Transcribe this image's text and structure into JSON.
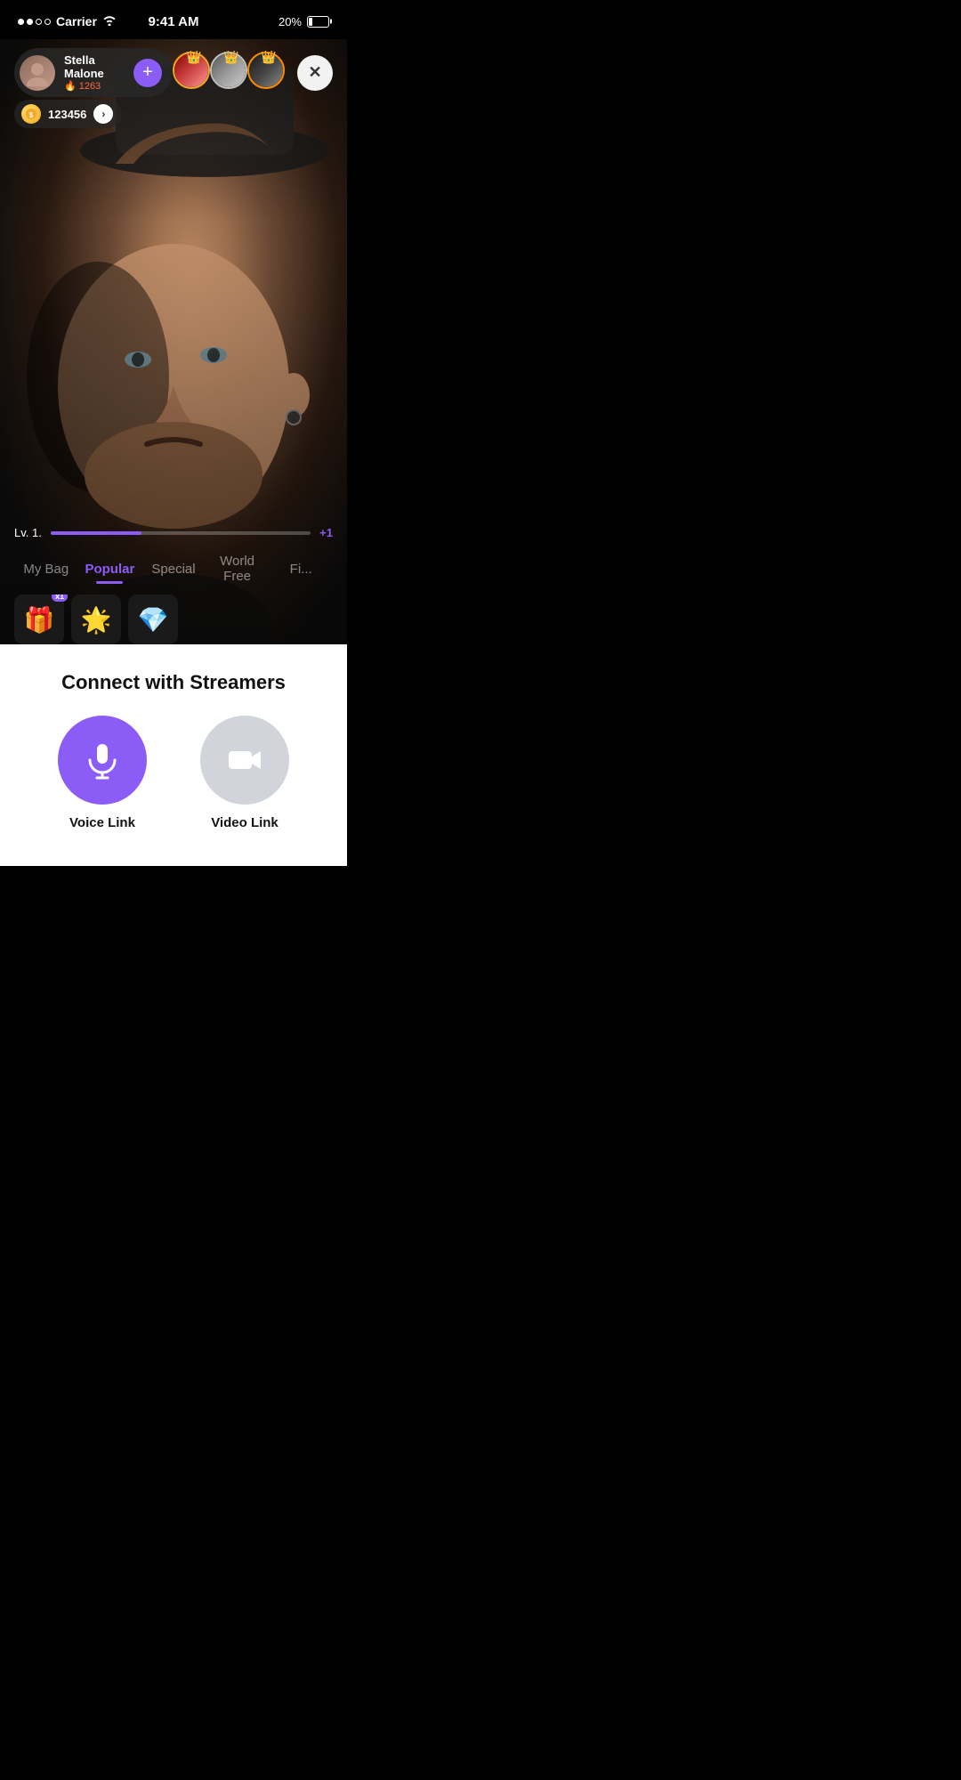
{
  "statusBar": {
    "carrier": "Carrier",
    "time": "9:41 AM",
    "battery": "20%"
  },
  "streamer": {
    "name": "Stella Malone",
    "fireCount": "1263",
    "followLabel": "+"
  },
  "coins": {
    "count": "123456"
  },
  "topViewers": [
    {
      "rank": "gold",
      "crown": "👑"
    },
    {
      "rank": "silver",
      "crown": "👑"
    },
    {
      "rank": "orange",
      "crown": "👑"
    }
  ],
  "level": {
    "label": "Lv. 1.",
    "fillPercent": 35,
    "plusLabel": "+1"
  },
  "tabs": [
    {
      "id": "my-bag",
      "label": "My Bag",
      "active": false
    },
    {
      "id": "popular",
      "label": "Popular",
      "active": true
    },
    {
      "id": "special",
      "label": "Special",
      "active": false
    },
    {
      "id": "world-free",
      "label": "World Free",
      "active": false
    },
    {
      "id": "fi",
      "label": "Fi...",
      "active": false
    }
  ],
  "bottomPanel": {
    "title": "Connect with Streamers",
    "voiceLink": "Voice Link",
    "videoLink": "Video Link"
  }
}
